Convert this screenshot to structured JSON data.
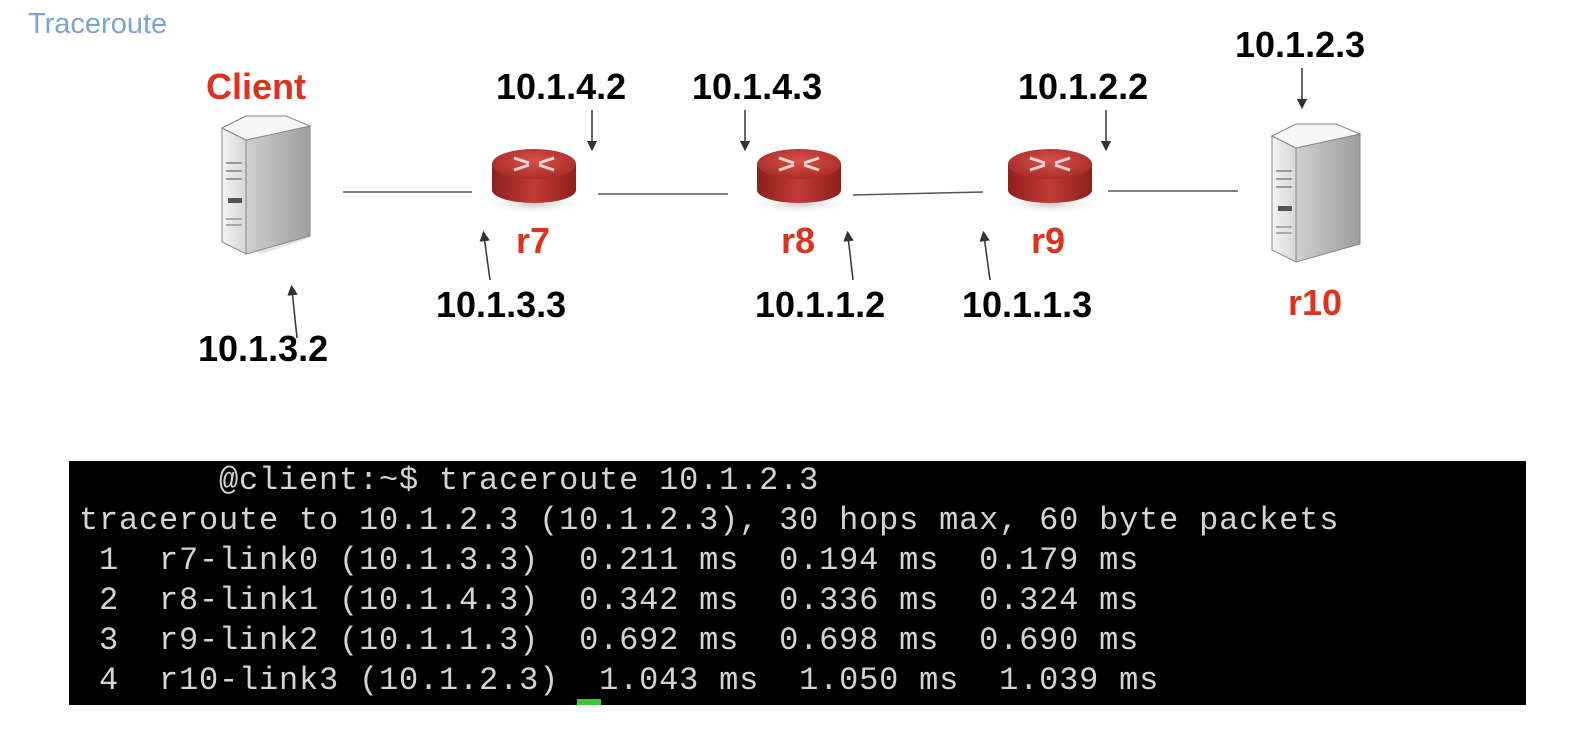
{
  "title": "Traceroute",
  "devices": {
    "client": "Client",
    "r7": "r7",
    "r8": "r8",
    "r9": "r9",
    "r10": "r10"
  },
  "ips": {
    "r7_upper": "10.1.4.2",
    "r8_upper": "10.1.4.3",
    "r9_upper": "10.1.2.2",
    "r10_upper": "10.1.2.3",
    "r7_lower": "10.1.3.3",
    "r8_lower": "10.1.1.2",
    "r9_lower": "10.1.1.3",
    "client_lower": "10.1.3.2"
  },
  "terminal": {
    "lines": [
      "       @client:~$ traceroute 10.1.2.3",
      "traceroute to 10.1.2.3 (10.1.2.3), 30 hops max, 60 byte packets",
      " 1  r7-link0 (10.1.3.3)  0.211 ms  0.194 ms  0.179 ms",
      " 2  r8-link1 (10.1.4.3)  0.342 ms  0.336 ms  0.324 ms",
      " 3  r9-link2 (10.1.1.3)  0.692 ms  0.698 ms  0.690 ms",
      " 4  r10-link3 (10.1.2.3)  1.043 ms  1.050 ms  1.039 ms"
    ]
  },
  "colors": {
    "title": "#7aa4d4",
    "device_label": "#e0301e",
    "router": "#b8332f",
    "terminal_bg": "#000000",
    "terminal_text": "#d4d4d4",
    "cursor": "#33cc33"
  },
  "icons": {
    "client": "server-icon",
    "r7": "router-icon",
    "r8": "router-icon",
    "r9": "router-icon",
    "r10": "server-icon"
  }
}
